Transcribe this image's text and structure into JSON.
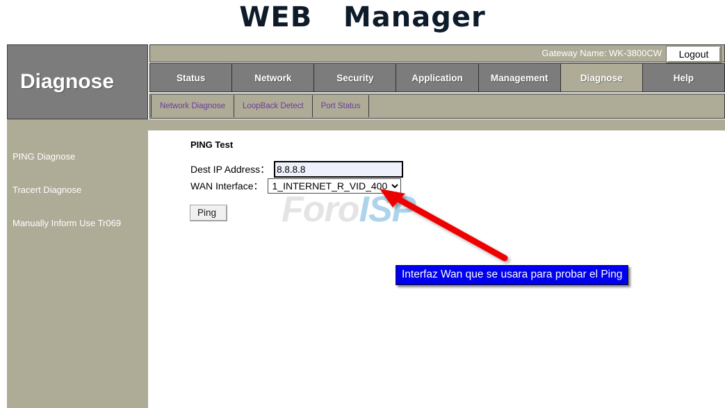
{
  "banner": {
    "title": "WEB   Manager"
  },
  "side_header": {
    "title": "Diagnose"
  },
  "gateway_bar": {
    "gateway_name": "Gateway Name: WK-3800CW",
    "logout_label": "Logout"
  },
  "nav": {
    "tabs": [
      {
        "label": "Status",
        "active": false
      },
      {
        "label": "Network",
        "active": false
      },
      {
        "label": "Security",
        "active": false
      },
      {
        "label": "Application",
        "active": false
      },
      {
        "label": "Management",
        "active": false
      },
      {
        "label": "Diagnose",
        "active": true
      },
      {
        "label": "Help",
        "active": false
      }
    ]
  },
  "subnav": {
    "tabs": [
      {
        "label": "Network Diagnose"
      },
      {
        "label": "LoopBack Detect"
      },
      {
        "label": "Port Status"
      }
    ]
  },
  "sidebar": {
    "items": [
      {
        "label": "PING Diagnose"
      },
      {
        "label": "Tracert Diagnose"
      },
      {
        "label": "Manually Inform Use Tr069"
      }
    ]
  },
  "form": {
    "title": "PING Test",
    "dest_ip_label": "Dest IP Address：",
    "dest_ip_value": "8.8.8.8",
    "dest_ip_placeholder": "",
    "wan_label": "WAN Interface：",
    "wan_selected": "1_INTERNET_R_VID_400",
    "wan_options": [
      "1_INTERNET_R_VID_400"
    ],
    "ping_label": "Ping"
  },
  "watermark": {
    "part1": "Foro",
    "part2": "ISP"
  },
  "annotation": {
    "text": "Interfaz Wan que se usara para probar el Ping",
    "box_color": "#0000ee",
    "arrow_color": "#ee0000"
  }
}
